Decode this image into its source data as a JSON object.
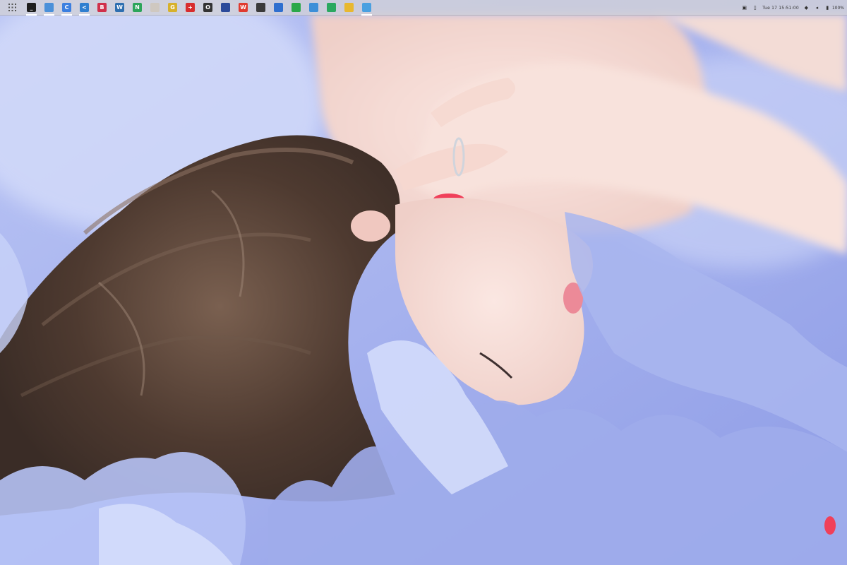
{
  "desktop": {
    "wallpaper": {
      "description_colors": {
        "tulle": "#9aa8ee",
        "tulle_light": "#c8d2fa",
        "skin": "#f6dcd6",
        "hair": "#5a4438",
        "nail": "#f0405a"
      }
    }
  },
  "top_panel": {
    "launcher_icon": "app-grid-icon",
    "dock_apps": [
      {
        "icon": "terminal-icon",
        "glyph": "_",
        "color": "#1e1e1e",
        "running": true
      },
      {
        "icon": "file-manager-icon",
        "glyph": "",
        "color": "#4a90d9",
        "running": true
      },
      {
        "icon": "chromium-icon",
        "glyph": "C",
        "color": "#3b7fe0",
        "running": true
      },
      {
        "icon": "vscode-icon",
        "glyph": "<",
        "color": "#2f7fd0",
        "running": true
      },
      {
        "icon": "ebook-reader-icon",
        "glyph": "B",
        "color": "#d0304a",
        "running": false
      },
      {
        "icon": "wordpress-icon",
        "glyph": "W",
        "color": "#2e6fb0",
        "running": false
      },
      {
        "icon": "network-monitor-icon",
        "glyph": "N",
        "color": "#2ca55a",
        "running": false
      },
      {
        "icon": "sheep-app-icon",
        "glyph": "",
        "color": "#cfc8c0",
        "running": false
      },
      {
        "icon": "notes-app-icon",
        "glyph": "G",
        "color": "#d7b12b",
        "running": false
      },
      {
        "icon": "netease-icon",
        "glyph": "+",
        "color": "#d82d2d",
        "running": false
      },
      {
        "icon": "github-icon",
        "glyph": "O",
        "color": "#333333",
        "running": false
      },
      {
        "icon": "screenshot-tool-icon",
        "glyph": "",
        "color": "#2b4a9a",
        "running": false
      },
      {
        "icon": "weibo-icon",
        "glyph": "W",
        "color": "#e03a2f",
        "running": false
      },
      {
        "icon": "system-monitor-icon",
        "glyph": "",
        "color": "#3a3a3a",
        "running": false
      },
      {
        "icon": "feather-app-icon",
        "glyph": "",
        "color": "#2f6fcf",
        "running": false
      },
      {
        "icon": "play-store-icon",
        "glyph": "",
        "color": "#2aa84a",
        "running": false
      },
      {
        "icon": "writer-doc-icon",
        "glyph": "",
        "color": "#3d8fd8",
        "running": false
      },
      {
        "icon": "spreadsheet-icon",
        "glyph": "",
        "color": "#2aa860",
        "running": false
      },
      {
        "icon": "presentation-icon",
        "glyph": "",
        "color": "#e8b830",
        "running": false
      },
      {
        "icon": "image-viewer-icon",
        "glyph": "",
        "color": "#4aa0e0",
        "running": true
      }
    ],
    "tray": {
      "clock": "Tue 17 15:51:00",
      "battery_label": "100%"
    }
  }
}
